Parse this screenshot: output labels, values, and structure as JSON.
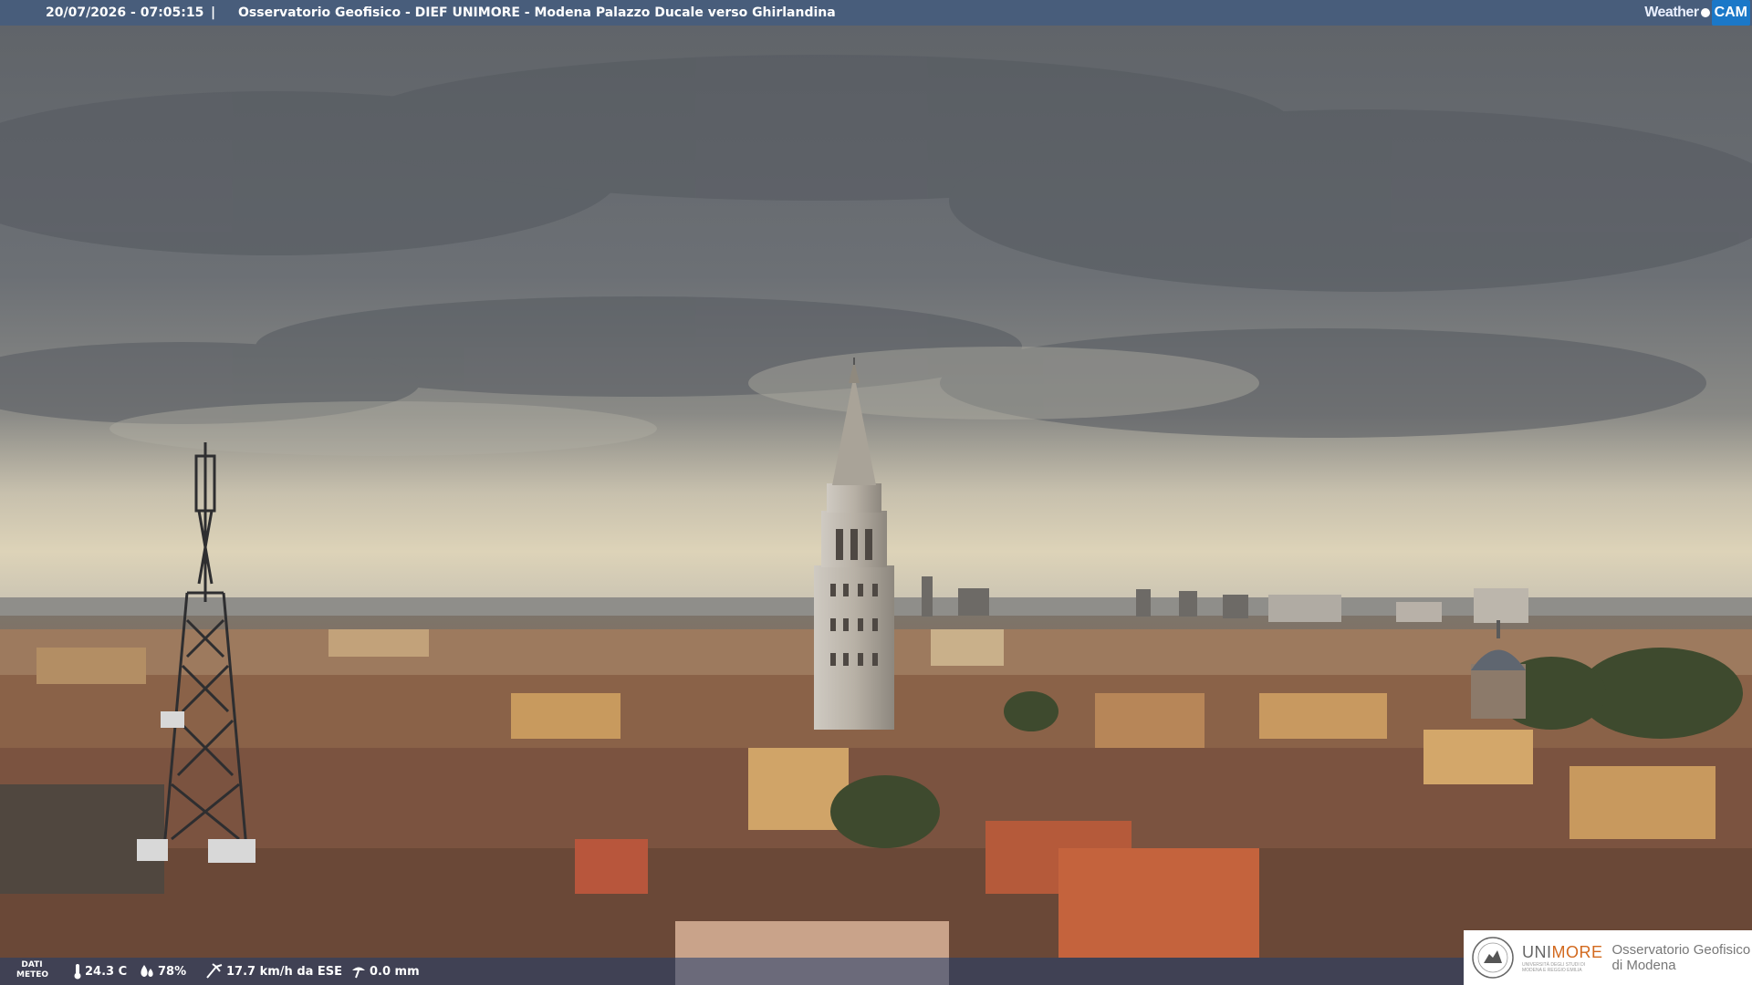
{
  "overlay": {
    "timestamp": "20/07/2026 - 07:05:15",
    "separator": "|",
    "caption": "Osservatorio Geofisico - DIEF UNIMORE - Modena Palazzo Ducale verso Ghirlandina",
    "brand_weather": "Weather",
    "brand_cam": "CAM"
  },
  "meteo": {
    "label_line1": "DATI",
    "label_line2": "METEO",
    "temperature": "24.3 C",
    "humidity": "78%",
    "wind": "17.7 km/h da ESE",
    "rain": "0.0 mm"
  },
  "logo": {
    "uni_prefix": "UNI",
    "uni_suffix": "MORE",
    "uni_sub1": "UNIVERSITÀ DEGLI STUDI DI",
    "uni_sub2": "MODENA E REGGIO EMILIA",
    "observatory_line1": "Osservatorio Geofisico",
    "observatory_line2": "di Modena"
  },
  "colors": {
    "bar": "#465c7d",
    "cam_blue": "#1b78c8",
    "unimore_orange": "#d2691e"
  },
  "icons": [
    "thermometer-icon",
    "humidity-drop-icon",
    "wind-icon",
    "rain-gauge-icon",
    "unimore-seal-icon"
  ]
}
